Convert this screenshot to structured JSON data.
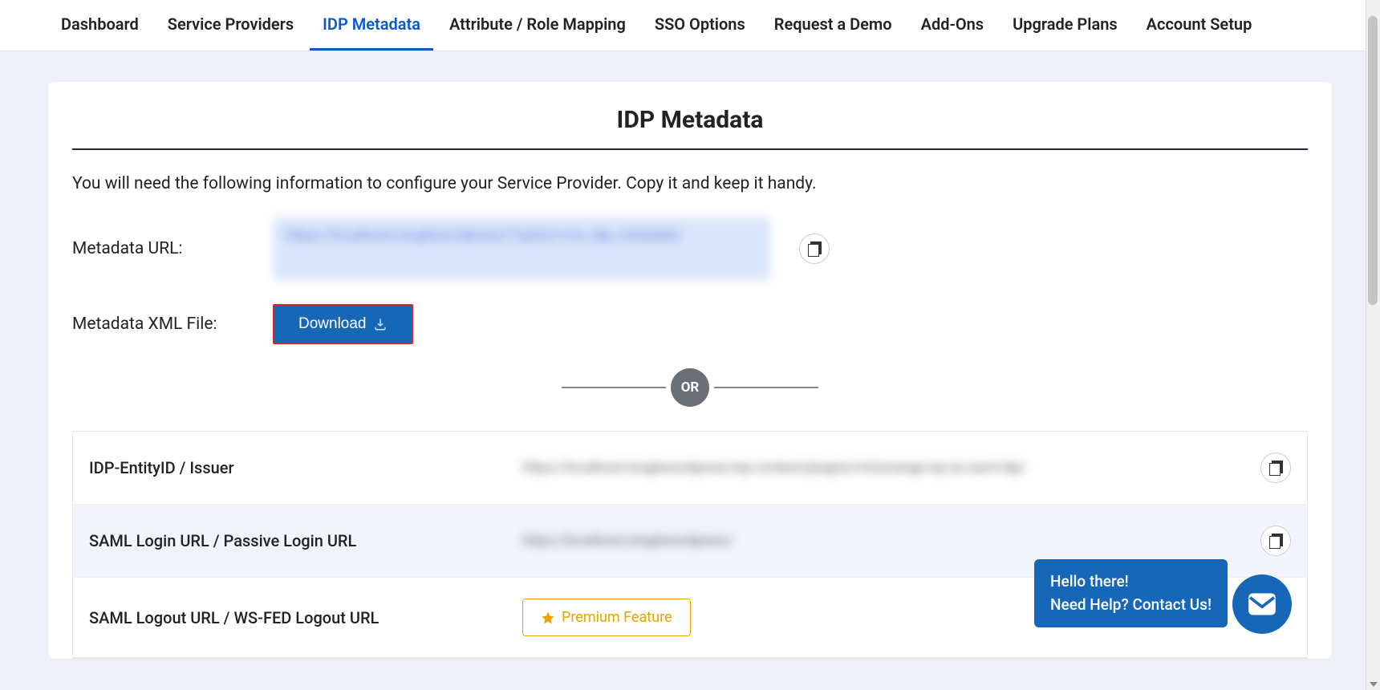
{
  "tabs": [
    {
      "label": "Dashboard"
    },
    {
      "label": "Service Providers"
    },
    {
      "label": "IDP Metadata"
    },
    {
      "label": "Attribute / Role Mapping"
    },
    {
      "label": "SSO Options"
    },
    {
      "label": "Request a Demo"
    },
    {
      "label": "Add-Ons"
    },
    {
      "label": "Upgrade Plans"
    },
    {
      "label": "Account Setup"
    }
  ],
  "active_tab_index": 2,
  "card": {
    "title": "IDP Metadata",
    "description": "You will need the following information to configure your Service Provider. Copy it and keep it handy.",
    "metadata_url_label": "Metadata URL:",
    "metadata_url_value": "https://localhost/singlewordpress/?option=mo_idp_metadata",
    "metadata_xml_label": "Metadata XML File:",
    "download_label": "Download",
    "or_label": "OR",
    "rows": [
      {
        "label": "IDP-EntityID / Issuer",
        "value": "https://localhost/singlewordpress/wp-content/plugins/miniorange-wp-as-saml-idp/"
      },
      {
        "label": "SAML Login URL / Passive Login URL",
        "value": "https://localhost/singlewordpress/"
      },
      {
        "label": "SAML Logout URL / WS-FED Logout URL",
        "value": ""
      }
    ],
    "premium_label": "Premium Feature"
  },
  "chat": {
    "line1": "Hello there!",
    "line2": "Need Help? Contact Us!"
  }
}
